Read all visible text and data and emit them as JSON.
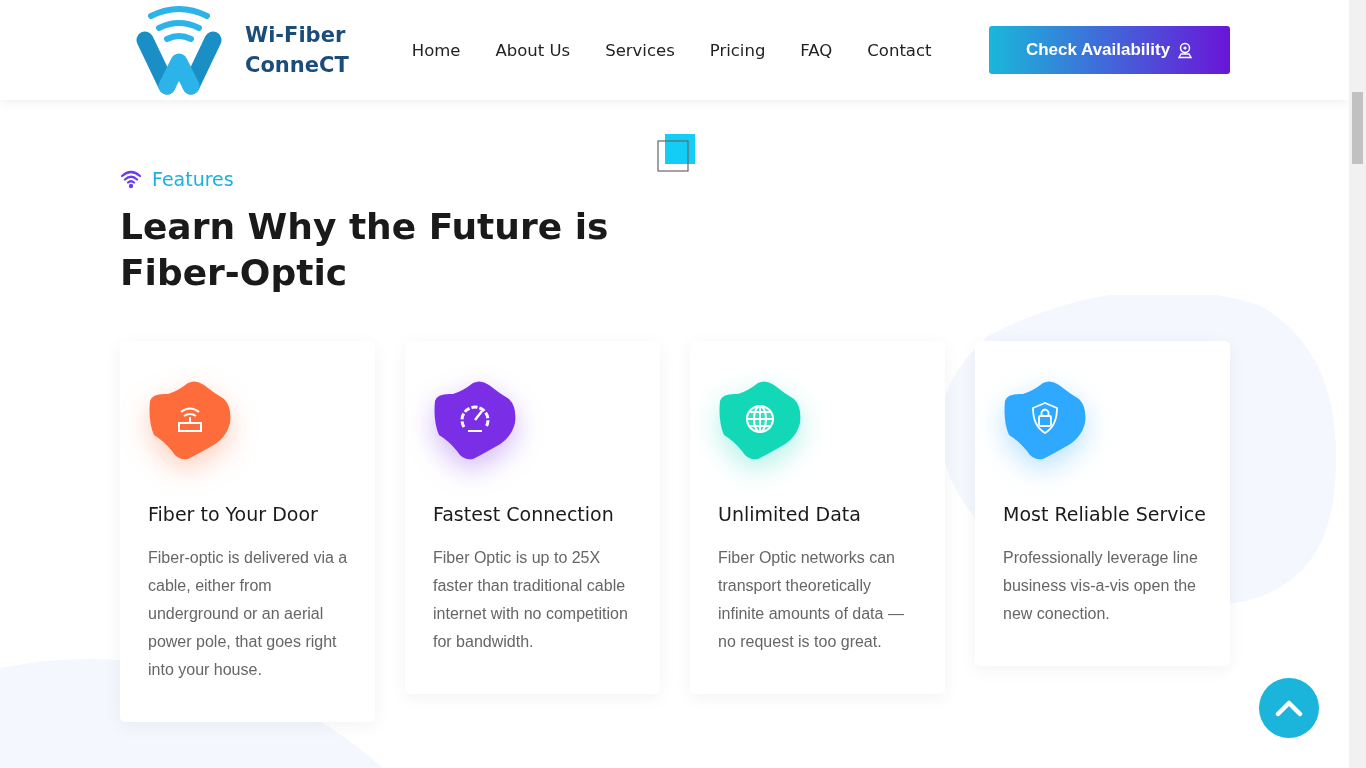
{
  "header": {
    "logo": {
      "line_1": "Wi-Fiber",
      "line_2": "ConneCT"
    },
    "nav": [
      {
        "label": "Home"
      },
      {
        "label": "About Us"
      },
      {
        "label": "Services"
      },
      {
        "label": "Pricing"
      },
      {
        "label": "FAQ"
      },
      {
        "label": "Contact"
      }
    ],
    "cta": {
      "label": "Check Availability"
    }
  },
  "section": {
    "eyebrow": "Features",
    "heading": "Learn Why the Future is Fiber-Optic",
    "cards": [
      {
        "kind": "router",
        "color": "#fd6c3a",
        "title": "Fiber to Your Door",
        "text": "Fiber-optic is delivered via a cable, either from underground or an aerial power pole, that goes right into your house."
      },
      {
        "kind": "speed",
        "color": "#7a2ee6",
        "title": "Fastest Connection",
        "text": "Fiber Optic is up to 25X faster than traditional cable internet with no competition for bandwidth."
      },
      {
        "kind": "globe",
        "color": "#12d8b8",
        "title": "Unlimited Data",
        "text": "Fiber Optic networks can transport theoretically infinite amounts of data — no request is too great."
      },
      {
        "kind": "shield",
        "color": "#2fa8ff",
        "title": "Most Reliable Service",
        "text": "Professionally leverage line business vis-a-vis open the new conection."
      }
    ]
  }
}
